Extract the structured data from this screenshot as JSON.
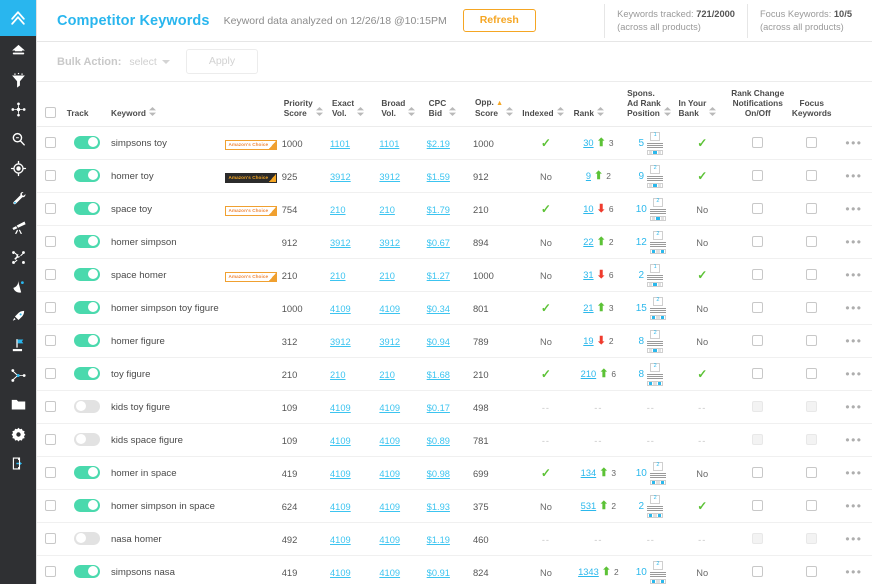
{
  "app": {
    "accent_blue": "#29b6ee",
    "accent_orange": "#f5a623",
    "toggle_green": "#4ad9ad",
    "link_blue": "#2bb8ec",
    "up_green": "#5cc236",
    "down_red": "#ef3b2d"
  },
  "sidebar": {
    "logo_name": "chevron-up-logo",
    "items": [
      {
        "name": "home-icon",
        "label": "Home"
      },
      {
        "name": "funnel-icon",
        "label": "Funnel"
      },
      {
        "name": "molecule-icon",
        "label": "Keyword Scout"
      },
      {
        "name": "magnifier-icon",
        "label": "Search"
      },
      {
        "name": "target-icon",
        "label": "Targeting"
      },
      {
        "name": "wrench-icon",
        "label": "Tools"
      },
      {
        "name": "telescope-icon",
        "label": "Telescope"
      },
      {
        "name": "network-wrench-icon",
        "label": "Automation"
      },
      {
        "name": "satellite-dish-icon",
        "label": "Monitor"
      },
      {
        "name": "rocket-icon",
        "label": "Launch"
      },
      {
        "name": "flag-icon",
        "label": "Campaigns"
      },
      {
        "name": "share-nodes-icon",
        "label": "Share"
      },
      {
        "name": "folder-icon",
        "label": "Files"
      },
      {
        "name": "gear-icon",
        "label": "Settings"
      },
      {
        "name": "logout-icon",
        "label": "Log out"
      }
    ]
  },
  "header": {
    "title": "Competitor Keywords",
    "analyzed_text": "Keyword data analyzed on 12/26/18 @10:15PM",
    "refresh_label": "Refresh",
    "kpis": [
      {
        "label": "Keywords tracked:",
        "value": "721/2000",
        "sub": "(across all products)"
      },
      {
        "label": "Focus Keywords:",
        "value": "10/5",
        "sub": "(across all products)"
      }
    ]
  },
  "bulkbar": {
    "label": "Bulk Action:",
    "select_value": "select",
    "apply_label": "Apply"
  },
  "table": {
    "columns": [
      {
        "key": "checkbox",
        "label": ""
      },
      {
        "key": "track",
        "label": "Track",
        "sortable": false
      },
      {
        "key": "keyword",
        "label": "Keyword",
        "sortable": true
      },
      {
        "key": "badge",
        "label": ""
      },
      {
        "key": "priority_score",
        "label": "Priority Score",
        "sortable": true
      },
      {
        "key": "exact_vol",
        "label": "Exact Vol.",
        "sortable": true
      },
      {
        "key": "broad_vol",
        "label": "Broad Vol.",
        "sortable": true
      },
      {
        "key": "cpc_bid",
        "label": "CPC Bid",
        "sortable": true
      },
      {
        "key": "opp_score",
        "label": "Opp. Score",
        "sortable": true,
        "flag": true
      },
      {
        "key": "indexed",
        "label": "Indexed",
        "sortable": true
      },
      {
        "key": "rank",
        "label": "Rank",
        "sortable": true
      },
      {
        "key": "spons_ad_rank",
        "label": "Spons. Ad Rank Position",
        "sortable": true
      },
      {
        "key": "in_your_bank",
        "label": "In Your Bank",
        "sortable": true
      },
      {
        "key": "rank_change_notifications",
        "label": "Rank Change Notifications On/Off",
        "sortable": false
      },
      {
        "key": "focus_keywords",
        "label": "Focus Keywords",
        "sortable": false
      },
      {
        "key": "actions",
        "label": ""
      }
    ],
    "rows": [
      {
        "checked": false,
        "track": true,
        "keyword": "simpsons toy",
        "badge": "Amazon's Choice",
        "badge_style": "light",
        "priority_score": "1000",
        "exact_vol": "1101",
        "broad_vol": "1101",
        "cpc_bid": "$2.19",
        "opp_score": "1000",
        "indexed": "yes",
        "rank": "30",
        "rank_dir": "up",
        "rank_delta": "3",
        "spons_num": "5",
        "spons_thumb": "1",
        "spons_fill": 1,
        "in_your_bank": "yes",
        "notif": false,
        "focus": false,
        "disabled": false
      },
      {
        "checked": false,
        "track": true,
        "keyword": "homer toy",
        "badge": "Amazon's Choice",
        "badge_style": "dark",
        "priority_score": "925",
        "exact_vol": "3912",
        "broad_vol": "3912",
        "cpc_bid": "$1.59",
        "opp_score": "912",
        "indexed": "No",
        "rank": "9",
        "rank_dir": "up",
        "rank_delta": "2",
        "spons_num": "9",
        "spons_thumb": "2",
        "spons_fill": 1,
        "in_your_bank": "yes",
        "notif": false,
        "focus": false,
        "disabled": false
      },
      {
        "checked": false,
        "track": true,
        "keyword": "space toy",
        "badge": "Amazon's Choice",
        "badge_style": "light",
        "priority_score": "754",
        "exact_vol": "210",
        "broad_vol": "210",
        "cpc_bid": "$1.79",
        "opp_score": "210",
        "indexed": "yes",
        "rank": "10",
        "rank_dir": "down",
        "rank_delta": "6",
        "spons_num": "10",
        "spons_thumb": "2",
        "spons_fill": 1,
        "in_your_bank": "No",
        "notif": false,
        "focus": false,
        "disabled": false
      },
      {
        "checked": false,
        "track": true,
        "keyword": "homer simpson",
        "badge": "",
        "badge_style": "",
        "priority_score": "912",
        "exact_vol": "3912",
        "broad_vol": "3912",
        "cpc_bid": "$0.67",
        "opp_score": "894",
        "indexed": "No",
        "rank": "22",
        "rank_dir": "up",
        "rank_delta": "2",
        "spons_num": "12",
        "spons_thumb": "2",
        "spons_fill": 2,
        "in_your_bank": "No",
        "notif": false,
        "focus": false,
        "disabled": false
      },
      {
        "checked": false,
        "track": true,
        "keyword": "space homer",
        "badge": "Amazon's Choice",
        "badge_style": "light",
        "priority_score": "210",
        "exact_vol": "210",
        "broad_vol": "210",
        "cpc_bid": "$1.27",
        "opp_score": "1000",
        "indexed": "No",
        "rank": "31",
        "rank_dir": "down",
        "rank_delta": "6",
        "spons_num": "2",
        "spons_thumb": "1",
        "spons_fill": 1,
        "in_your_bank": "yes",
        "notif": false,
        "focus": false,
        "disabled": false
      },
      {
        "checked": false,
        "track": true,
        "keyword": "homer simpson toy figure",
        "badge": "",
        "badge_style": "",
        "priority_score": "1000",
        "exact_vol": "4109",
        "broad_vol": "4109",
        "cpc_bid": "$0.34",
        "opp_score": "801",
        "indexed": "yes",
        "rank": "21",
        "rank_dir": "up",
        "rank_delta": "3",
        "spons_num": "15",
        "spons_thumb": "2",
        "spons_fill": 2,
        "in_your_bank": "No",
        "notif": false,
        "focus": false,
        "disabled": false
      },
      {
        "checked": false,
        "track": true,
        "keyword": "homer figure",
        "badge": "",
        "badge_style": "",
        "priority_score": "312",
        "exact_vol": "3912",
        "broad_vol": "3912",
        "cpc_bid": "$0.94",
        "opp_score": "789",
        "indexed": "No",
        "rank": "19",
        "rank_dir": "down",
        "rank_delta": "2",
        "spons_num": "8",
        "spons_thumb": "2",
        "spons_fill": 1,
        "in_your_bank": "No",
        "notif": false,
        "focus": false,
        "disabled": false
      },
      {
        "checked": false,
        "track": true,
        "keyword": "toy figure",
        "badge": "",
        "badge_style": "",
        "priority_score": "210",
        "exact_vol": "210",
        "broad_vol": "210",
        "cpc_bid": "$1.68",
        "opp_score": "210",
        "indexed": "yes",
        "rank": "210",
        "rank_dir": "up",
        "rank_delta": "6",
        "spons_num": "8",
        "spons_thumb": "2",
        "spons_fill": 2,
        "in_your_bank": "yes",
        "notif": false,
        "focus": false,
        "disabled": false
      },
      {
        "checked": false,
        "track": false,
        "keyword": "kids toy figure",
        "badge": "",
        "badge_style": "",
        "priority_score": "109",
        "exact_vol": "4109",
        "broad_vol": "4109",
        "cpc_bid": "$0.17",
        "opp_score": "498",
        "indexed": "--",
        "rank": "--",
        "rank_dir": "",
        "rank_delta": "",
        "spons_num": "--",
        "spons_thumb": "",
        "spons_fill": 0,
        "in_your_bank": "--",
        "notif": false,
        "focus": false,
        "disabled": true
      },
      {
        "checked": false,
        "track": false,
        "keyword": "kids space figure",
        "badge": "",
        "badge_style": "",
        "priority_score": "109",
        "exact_vol": "4109",
        "broad_vol": "4109",
        "cpc_bid": "$0.89",
        "opp_score": "781",
        "indexed": "--",
        "rank": "--",
        "rank_dir": "",
        "rank_delta": "",
        "spons_num": "--",
        "spons_thumb": "",
        "spons_fill": 0,
        "in_your_bank": "--",
        "notif": false,
        "focus": false,
        "disabled": true
      },
      {
        "checked": false,
        "track": true,
        "keyword": "homer in space",
        "badge": "",
        "badge_style": "",
        "priority_score": "419",
        "exact_vol": "4109",
        "broad_vol": "4109",
        "cpc_bid": "$0.98",
        "opp_score": "699",
        "indexed": "yes",
        "rank": "134",
        "rank_dir": "up",
        "rank_delta": "3",
        "spons_num": "10",
        "spons_thumb": "2",
        "spons_fill": 2,
        "in_your_bank": "No",
        "notif": false,
        "focus": false,
        "disabled": false
      },
      {
        "checked": false,
        "track": true,
        "keyword": "homer simpson in space",
        "badge": "",
        "badge_style": "",
        "priority_score": "624",
        "exact_vol": "4109",
        "broad_vol": "4109",
        "cpc_bid": "$1.93",
        "opp_score": "375",
        "indexed": "No",
        "rank": "531",
        "rank_dir": "up",
        "rank_delta": "2",
        "spons_num": "2",
        "spons_thumb": "2",
        "spons_fill": 2,
        "in_your_bank": "yes",
        "notif": false,
        "focus": false,
        "disabled": false
      },
      {
        "checked": false,
        "track": false,
        "keyword": "nasa homer",
        "badge": "",
        "badge_style": "",
        "priority_score": "492",
        "exact_vol": "4109",
        "broad_vol": "4109",
        "cpc_bid": "$1.19",
        "opp_score": "460",
        "indexed": "--",
        "rank": "--",
        "rank_dir": "",
        "rank_delta": "",
        "spons_num": "--",
        "spons_thumb": "",
        "spons_fill": 0,
        "in_your_bank": "--",
        "notif": false,
        "focus": false,
        "disabled": true
      },
      {
        "checked": false,
        "track": true,
        "keyword": "simpsons nasa",
        "badge": "",
        "badge_style": "",
        "priority_score": "419",
        "exact_vol": "4109",
        "broad_vol": "4109",
        "cpc_bid": "$0.91",
        "opp_score": "824",
        "indexed": "No",
        "rank": "1343",
        "rank_dir": "up",
        "rank_delta": "2",
        "spons_num": "10",
        "spons_thumb": "2",
        "spons_fill": 2,
        "in_your_bank": "No",
        "notif": false,
        "focus": false,
        "disabled": false
      }
    ],
    "row_actions_glyph": "•••"
  }
}
